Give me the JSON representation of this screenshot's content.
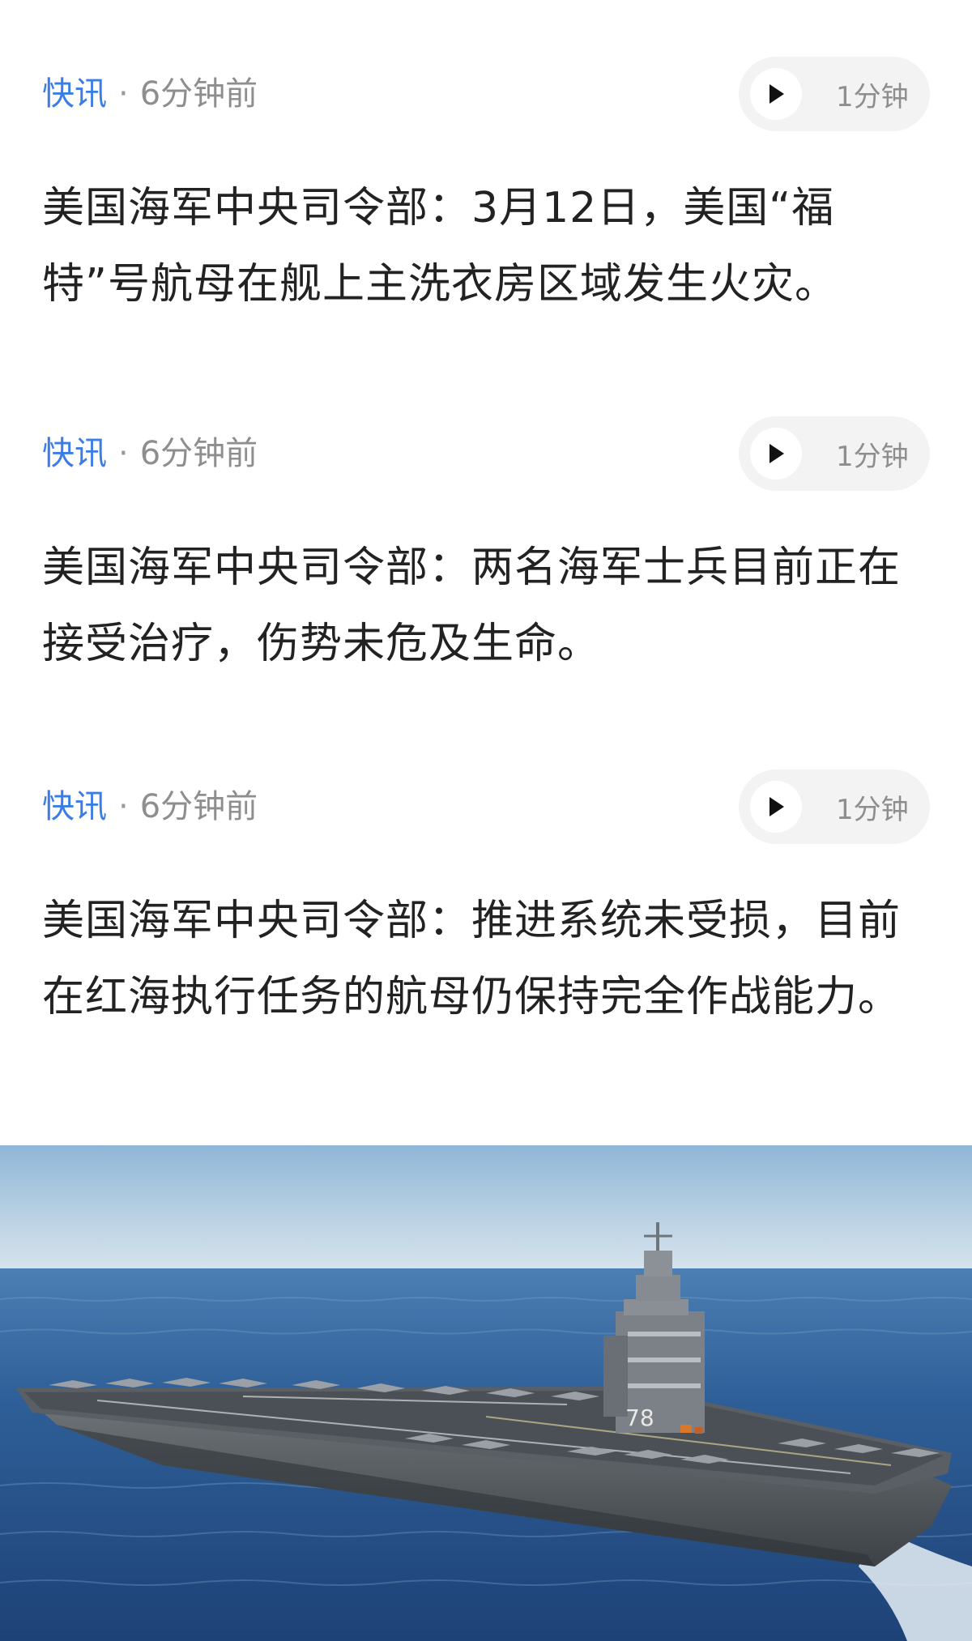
{
  "feed": {
    "items": [
      {
        "tag": "快讯",
        "separator": "·",
        "time": "6分钟前",
        "audio_duration": "1分钟",
        "text": "美国海军中央司令部：3月12日，美国“福特”号航母在舰上主洗衣房区域发生火灾。"
      },
      {
        "tag": "快讯",
        "separator": "·",
        "time": "6分钟前",
        "audio_duration": "1分钟",
        "text": "美国海军中央司令部：两名海军士兵目前正在接受治疗，伤势未危及生命。"
      },
      {
        "tag": "快讯",
        "separator": "·",
        "time": "6分钟前",
        "audio_duration": "1分钟",
        "text": "美国海军中央司令部：推进系统未受损，目前在红海执行任务的航母仍保持完全作战能力。"
      }
    ]
  },
  "photo": {
    "hull_number": "78"
  },
  "colors": {
    "accent": "#3b7de6",
    "meta_gray": "#8e8e8e",
    "body_text": "#222222",
    "pill_bg": "#f3f3f3"
  },
  "icons": {
    "play": "play-icon"
  }
}
